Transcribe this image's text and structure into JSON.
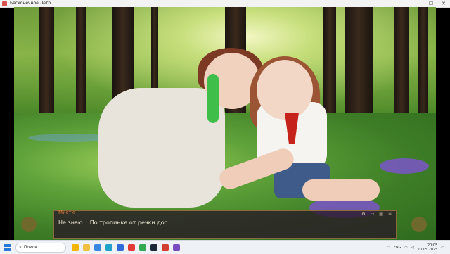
{
  "window": {
    "title": "Бесконечное Лето",
    "controls": [
      "—",
      "☐",
      "✕"
    ]
  },
  "dialog": {
    "speaker": "Мисти",
    "text": "Не знаю... По тропинке от речки дос",
    "icons": [
      "settings-icon",
      "save-icon",
      "load-icon",
      "menu-icon"
    ]
  },
  "taskbar": {
    "search_label": "Поиск",
    "apps": [
      {
        "name": "widgets-icon",
        "color": "#f5b400"
      },
      {
        "name": "files-icon",
        "color": "#f0c040"
      },
      {
        "name": "browser-icon",
        "color": "#3a87e0"
      },
      {
        "name": "edge-icon",
        "color": "#1fa3c9"
      },
      {
        "name": "mail-icon",
        "color": "#2f6bd6"
      },
      {
        "name": "yandex-icon",
        "color": "#e53935"
      },
      {
        "name": "chrome-icon",
        "color": "#34a853"
      },
      {
        "name": "steam-icon",
        "color": "#1b2838"
      },
      {
        "name": "media-icon",
        "color": "#d23f31"
      },
      {
        "name": "game-icon",
        "color": "#7a4cc2"
      }
    ],
    "tray": {
      "lang": "ENG",
      "time": "20:05",
      "date": "20.05.2025"
    }
  }
}
